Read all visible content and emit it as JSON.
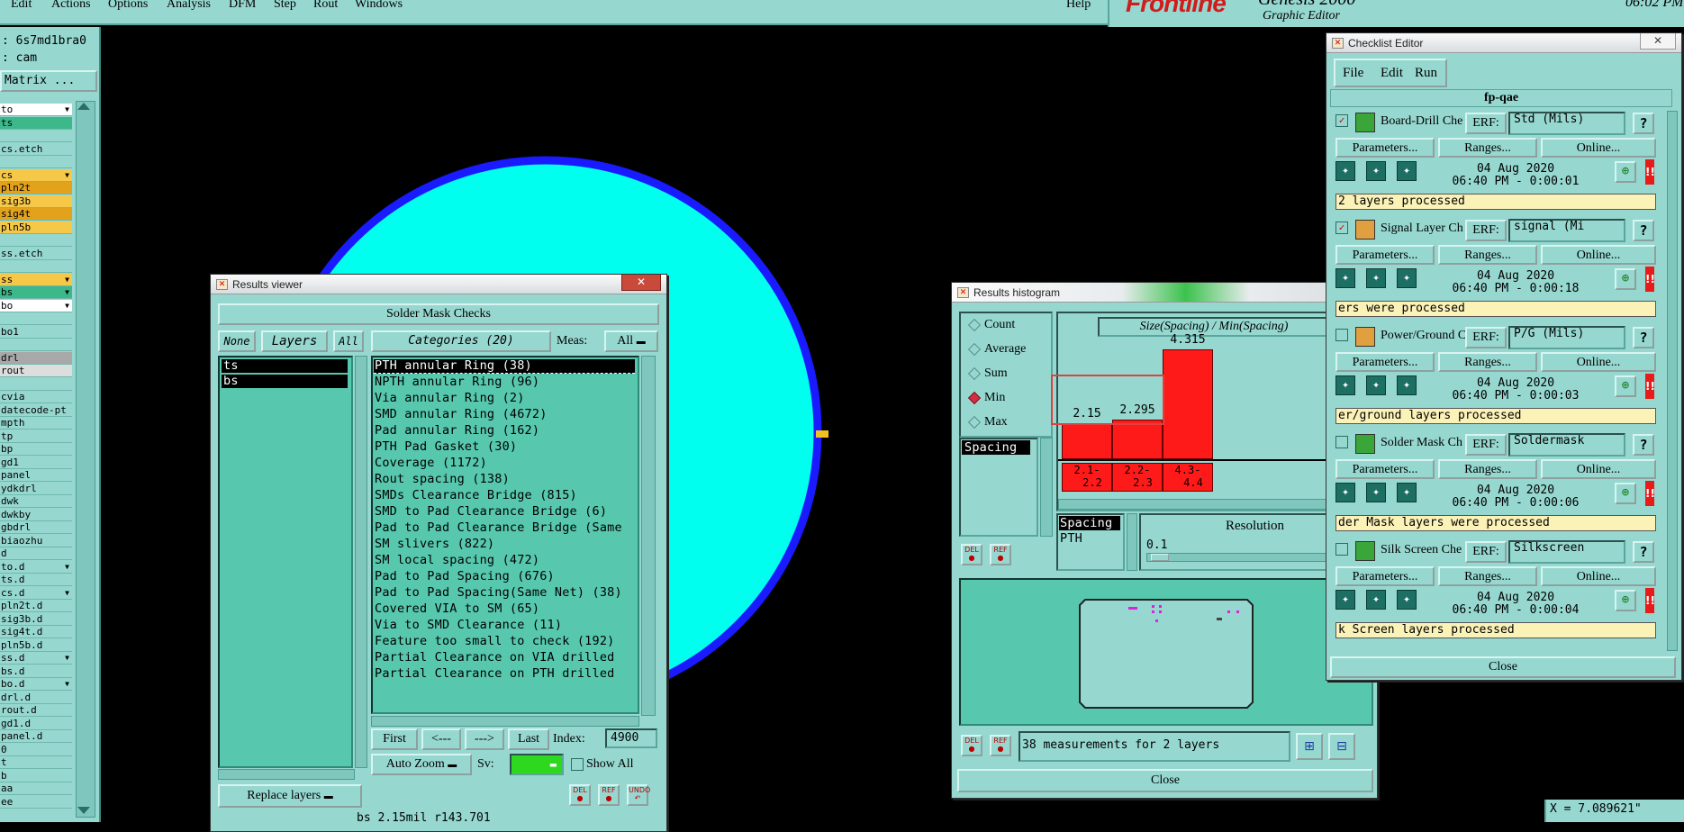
{
  "menubar": {
    "items": [
      "Edit",
      "Actions",
      "Options",
      "Analysis",
      "DFM",
      "Step",
      "Rout",
      "Windows"
    ],
    "help": "Help"
  },
  "brand": {
    "logo": "Frontline",
    "product": "Genesis 2000",
    "subtitle": "Graphic Editor",
    "clock": "06:02 PM"
  },
  "left_panel": {
    "job_label": ": 6s7md1bra0",
    "step_label": ": cam",
    "matrix_button": "Matrix ...",
    "layers": [
      {
        "name": "to",
        "color": "#ffffff",
        "mark": "▼"
      },
      {
        "name": "ts",
        "color": "#3cb88a",
        "mark": ""
      },
      {
        "name": "",
        "color": "#96d8d0",
        "mark": ""
      },
      {
        "name": "cs.etch",
        "color": "#96d8d0",
        "mark": ""
      },
      {
        "name": "",
        "color": "#96d8d0",
        "mark": ""
      },
      {
        "name": "cs",
        "color": "#f5c84a",
        "mark": "▼"
      },
      {
        "name": "pln2t",
        "color": "#e2a21c",
        "mark": ""
      },
      {
        "name": "sig3b",
        "color": "#f5c84a",
        "mark": ""
      },
      {
        "name": "sig4t",
        "color": "#e2a21c",
        "mark": ""
      },
      {
        "name": "pln5b",
        "color": "#f5c84a",
        "mark": ""
      },
      {
        "name": "",
        "color": "#96d8d0",
        "mark": ""
      },
      {
        "name": "ss.etch",
        "color": "#96d8d0",
        "mark": ""
      },
      {
        "name": "",
        "color": "#96d8d0",
        "mark": ""
      },
      {
        "name": "ss",
        "color": "#f5c84a",
        "mark": "▼"
      },
      {
        "name": "bs",
        "color": "#3cb88a",
        "mark": "▼"
      },
      {
        "name": "bo",
        "color": "#ffffff",
        "mark": "▼"
      },
      {
        "name": "",
        "color": "#96d8d0",
        "mark": ""
      },
      {
        "name": "bo1",
        "color": "#96d8d0",
        "mark": ""
      },
      {
        "name": "",
        "color": "#96d8d0",
        "mark": ""
      },
      {
        "name": "drl",
        "color": "#a8a8a8",
        "mark": ""
      },
      {
        "name": "rout",
        "color": "#dddddd",
        "mark": ""
      },
      {
        "name": "",
        "color": "#96d8d0",
        "mark": ""
      },
      {
        "name": "cvia",
        "color": "#96d8d0",
        "mark": ""
      },
      {
        "name": "datecode-pt",
        "color": "#96d8d0",
        "mark": ""
      },
      {
        "name": "mpth",
        "color": "#96d8d0",
        "mark": ""
      },
      {
        "name": "tp",
        "color": "#96d8d0",
        "mark": ""
      },
      {
        "name": "bp",
        "color": "#96d8d0",
        "mark": ""
      },
      {
        "name": "gd1",
        "color": "#96d8d0",
        "mark": ""
      },
      {
        "name": "panel",
        "color": "#96d8d0",
        "mark": ""
      },
      {
        "name": "ydkdrl",
        "color": "#96d8d0",
        "mark": ""
      },
      {
        "name": "dwk",
        "color": "#96d8d0",
        "mark": ""
      },
      {
        "name": "dwkby",
        "color": "#96d8d0",
        "mark": ""
      },
      {
        "name": "gbdrl",
        "color": "#96d8d0",
        "mark": ""
      },
      {
        "name": "biaozhu",
        "color": "#96d8d0",
        "mark": ""
      },
      {
        "name": "d",
        "color": "#96d8d0",
        "mark": ""
      },
      {
        "name": "to.d",
        "color": "#96d8d0",
        "mark": "▼"
      },
      {
        "name": "ts.d",
        "color": "#96d8d0",
        "mark": ""
      },
      {
        "name": "cs.d",
        "color": "#96d8d0",
        "mark": "▼"
      },
      {
        "name": "pln2t.d",
        "color": "#96d8d0",
        "mark": ""
      },
      {
        "name": "sig3b.d",
        "color": "#96d8d0",
        "mark": ""
      },
      {
        "name": "sig4t.d",
        "color": "#96d8d0",
        "mark": ""
      },
      {
        "name": "pln5b.d",
        "color": "#96d8d0",
        "mark": ""
      },
      {
        "name": "ss.d",
        "color": "#96d8d0",
        "mark": "▼"
      },
      {
        "name": "bs.d",
        "color": "#96d8d0",
        "mark": ""
      },
      {
        "name": "bo.d",
        "color": "#96d8d0",
        "mark": "▼"
      },
      {
        "name": "drl.d",
        "color": "#96d8d0",
        "mark": ""
      },
      {
        "name": "rout.d",
        "color": "#96d8d0",
        "mark": ""
      },
      {
        "name": "gd1.d",
        "color": "#96d8d0",
        "mark": ""
      },
      {
        "name": "panel.d",
        "color": "#96d8d0",
        "mark": ""
      },
      {
        "name": "0",
        "color": "#96d8d0",
        "mark": ""
      },
      {
        "name": "t",
        "color": "#96d8d0",
        "mark": ""
      },
      {
        "name": "b",
        "color": "#96d8d0",
        "mark": ""
      },
      {
        "name": "aa",
        "color": "#96d8d0",
        "mark": ""
      },
      {
        "name": "ee",
        "color": "#96d8d0",
        "mark": ""
      }
    ]
  },
  "results_viewer": {
    "title": "Results viewer",
    "header": "Solder Mask Checks",
    "none_button": "None",
    "layers_label": "Layers",
    "all_button": "All",
    "categories_label": "Categories (20)",
    "meas_label": "Meas:",
    "meas_value": "All",
    "layers": [
      "ts",
      "bs"
    ],
    "categories": [
      "PTH annular Ring (38)",
      "NPTH annular Ring (96)",
      "Via annular Ring (2)",
      "SMD annular Ring (4672)",
      "Pad annular Ring (162)",
      "PTH Pad Gasket (30)",
      "Coverage (1172)",
      "Rout spacing (138)",
      "SMDs Clearance Bridge (815)",
      "SMD to Pad Clearance Bridge (6)",
      "Pad to Pad Clearance Bridge (Same",
      "SM slivers (822)",
      "SM local spacing (472)",
      "Pad to Pad Spacing (676)",
      "Pad to Pad Spacing(Same Net) (38)",
      "Covered VIA to SM (65)",
      "Via to SMD Clearance (11)",
      "Feature too small to check (192)",
      "Partial Clearance on VIA drilled",
      "Partial Clearance on PTH drilled"
    ],
    "first_button": "First",
    "prev_button": "<---",
    "next_button": "--->",
    "last_button": "Last",
    "index_label": "Index:",
    "index_value": "4900",
    "auto_zoom": "Auto Zoom",
    "sv_label": "Sv:",
    "show_all": "Show All",
    "replace_layers": "Replace layers",
    "status_line": "bs 2.15mil r143.701"
  },
  "results_histogram": {
    "title": "Results histogram",
    "modes": [
      "Count",
      "Average",
      "Sum",
      "Min",
      "Max"
    ],
    "selected_mode": "Min",
    "measure_list": [
      "Spacing"
    ],
    "chart_title": "Size(Spacing) / Min(Spacing)",
    "bars": [
      {
        "value": "2.15",
        "range_top": "2.1-",
        "range_bottom": "2.2",
        "level": 0.33
      },
      {
        "value": "2.295",
        "range_top": "2.2-",
        "range_bottom": "2.3",
        "level": 0.36
      },
      {
        "value": "4.315",
        "range_top": "4.3-",
        "range_bottom": "4.4",
        "level": 1.0
      }
    ],
    "attr_list": [
      "Spacing",
      "PTH"
    ],
    "resolution_label": "Resolution",
    "resolution_value": "0.1",
    "footer_text": "38 measurements for 2 layers",
    "close_button": "Close"
  },
  "checklist_editor": {
    "title": "Checklist Editor",
    "menu": [
      "File",
      "Edit",
      "Run"
    ],
    "checklist_name": "fp-qae",
    "erf_label": "ERF:",
    "parameters_button": "Parameters...",
    "ranges_button": "Ranges...",
    "online_button": "Online...",
    "help_glyph": "?",
    "alert_glyph": "!!",
    "checks": [
      {
        "name": "Board-Drill Che",
        "erf": "Std (Mils)",
        "checked": true,
        "date": "04 Aug 2020",
        "time": "06:40 PM - 0:00:01",
        "status": "2 layers processed",
        "icon_color": "#3aa63a"
      },
      {
        "name": "Signal Layer Ch",
        "erf": "signal (Mi",
        "checked": true,
        "date": "04 Aug 2020",
        "time": "06:40 PM - 0:00:18",
        "status": "ers were processed",
        "icon_color": "#e0a040"
      },
      {
        "name": "Power/Ground C",
        "erf": "P/G (Mils)",
        "checked": false,
        "date": "04 Aug 2020",
        "time": "06:40 PM - 0:00:03",
        "status": "er/ground layers processed",
        "icon_color": "#e0a040"
      },
      {
        "name": "Solder Mask Ch",
        "erf": "Soldermask",
        "checked": false,
        "date": "04 Aug 2020",
        "time": "06:40 PM - 0:00:06",
        "status": "der Mask layers were processed",
        "icon_color": "#3aa63a"
      },
      {
        "name": "Silk Screen Che",
        "erf": "Silkscreen",
        "checked": false,
        "date": "04 Aug 2020",
        "time": "06:40 PM - 0:00:04",
        "status": "k Screen layers processed",
        "icon_color": "#3aa63a"
      }
    ],
    "close_button": "Close"
  },
  "coords": {
    "x": "X = 7.089621\""
  },
  "colors": {
    "accent": "#96d8d0",
    "panel": "#57c8ae",
    "board_fill": "#00ffee",
    "board_outline": "#1a1aff",
    "histogram_bar": "#ff1a1a",
    "status_bg": "#fbf2b8"
  },
  "icons": {
    "window": "window-icon",
    "close": "close-icon",
    "dropdown": "dropdown-arrow-icon",
    "check_run": "run-check-icon",
    "magnifier": "magnifier-icon"
  }
}
